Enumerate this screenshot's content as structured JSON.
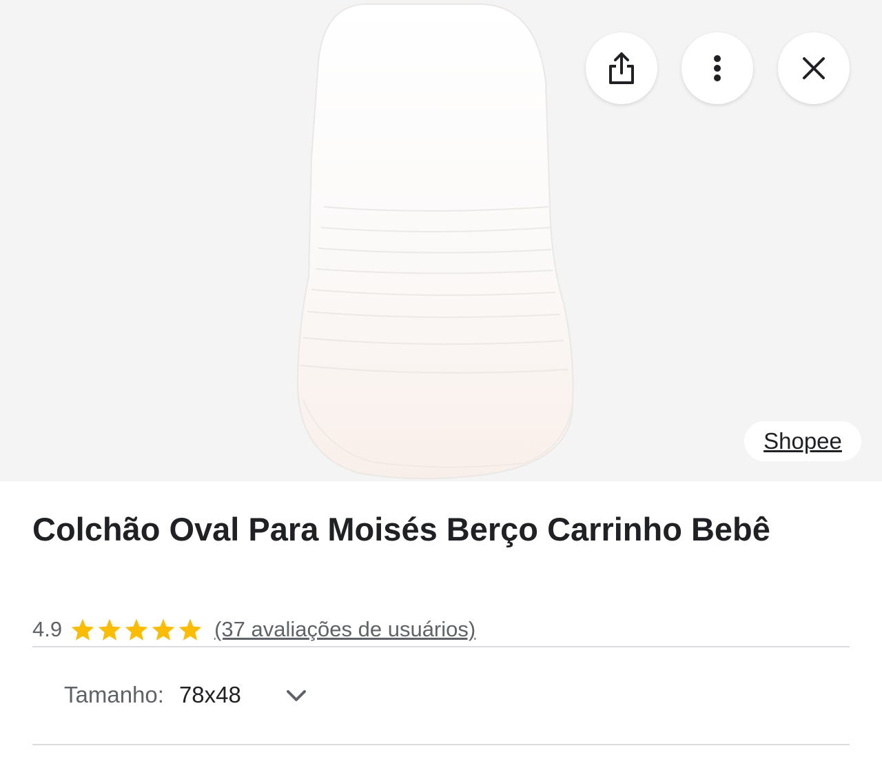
{
  "product": {
    "title": "Colchão Oval Para Moisés Berço Carrinho Bebê",
    "image_description": "white oval baby mattress"
  },
  "toolbar": {
    "share_icon": "share-icon",
    "more_icon": "more-vert-icon",
    "close_icon": "close-icon"
  },
  "source": {
    "label": "Shopee"
  },
  "rating": {
    "value": "4.9",
    "stars": 5,
    "reviews_label": "(37 avaliações de usuários)"
  },
  "variant": {
    "label": "Tamanho:",
    "value": "78x48"
  },
  "colors": {
    "star": "#fbbc04",
    "hero_bg": "#f4f4f4",
    "text_primary": "#202124",
    "text_secondary": "#5f6368"
  }
}
